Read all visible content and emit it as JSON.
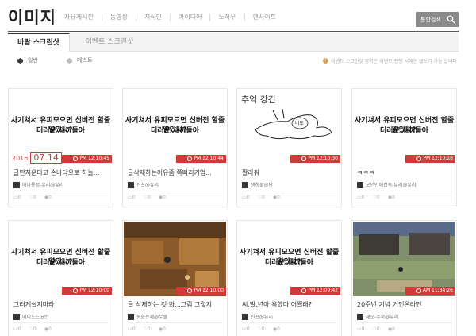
{
  "site": {
    "title": "이미지"
  },
  "nav": [
    "자유게시판",
    "동영상",
    "지식인",
    "아이디어",
    "노하우",
    "팬사이트"
  ],
  "search": {
    "label": "통합검색",
    "icon": "search-icon"
  },
  "tabs": [
    {
      "label": "바람 스크린샷",
      "active": true
    },
    {
      "label": "이벤트 스크린샷",
      "active": false
    }
  ],
  "subnav": [
    {
      "label": "일반",
      "icon": "general-icon"
    },
    {
      "label": "메스트",
      "icon": "best-icon"
    }
  ],
  "notice": "이벤트 스크린샷 영역은 이벤트 진행 시에만 글쓰기 가능 합니다",
  "caption_text": {
    "line1": "사기쳐서 유피모으면 신버전 할줄알았나?",
    "line2": "더러운 새끼들아"
  },
  "sketch_text": "추억 강간",
  "sketch_inner": "버도",
  "date_tag": {
    "year": "2016",
    "day": "07.14"
  },
  "cards": [
    {
      "time": "PM 12:10:45",
      "title": "글만지운다고 손바닥으로 하늘...",
      "author": "매나룡정-유리@유리",
      "stats": [
        "0",
        "0",
        "0"
      ]
    },
    {
      "time": "PM 12:10:44",
      "title": "글삭제하는이유좀 쪽빠리기업...",
      "author": "신프@유리",
      "stats": [
        "0",
        "0",
        "0"
      ]
    },
    {
      "time": "PM 12:10:30",
      "title": "짤라줘",
      "author": "생청둘@만",
      "stats": [
        "0",
        "0",
        "0"
      ]
    },
    {
      "time": "PM 12:10:28",
      "title": "ㅋㅋㅋ",
      "author": "오년만에접속-유리@유리",
      "stats": [
        "0",
        "0",
        "0"
      ]
    },
    {
      "time": "PM 12:10:00",
      "title": "그러게실지마라",
      "author": "메이드드@만",
      "stats": [
        "0",
        "0",
        "0"
      ]
    },
    {
      "time": "PM 12:10:00",
      "title": "글 삭제하는 것 봐...그럼 그렇지",
      "author": "동화은제@무쿨",
      "stats": [
        "0",
        "0",
        "0"
      ]
    },
    {
      "time": "PM 12:09:42",
      "title": "씨.발.년아 욕했다 어쩔래?",
      "author": "신프@유리",
      "stats": [
        "0",
        "0",
        "0"
      ]
    },
    {
      "time": "AM 11:34:26",
      "title": "20주년 기념 거인온라인",
      "author": "제오-주작@유리",
      "stats": [
        "0",
        "0",
        "0"
      ]
    }
  ]
}
